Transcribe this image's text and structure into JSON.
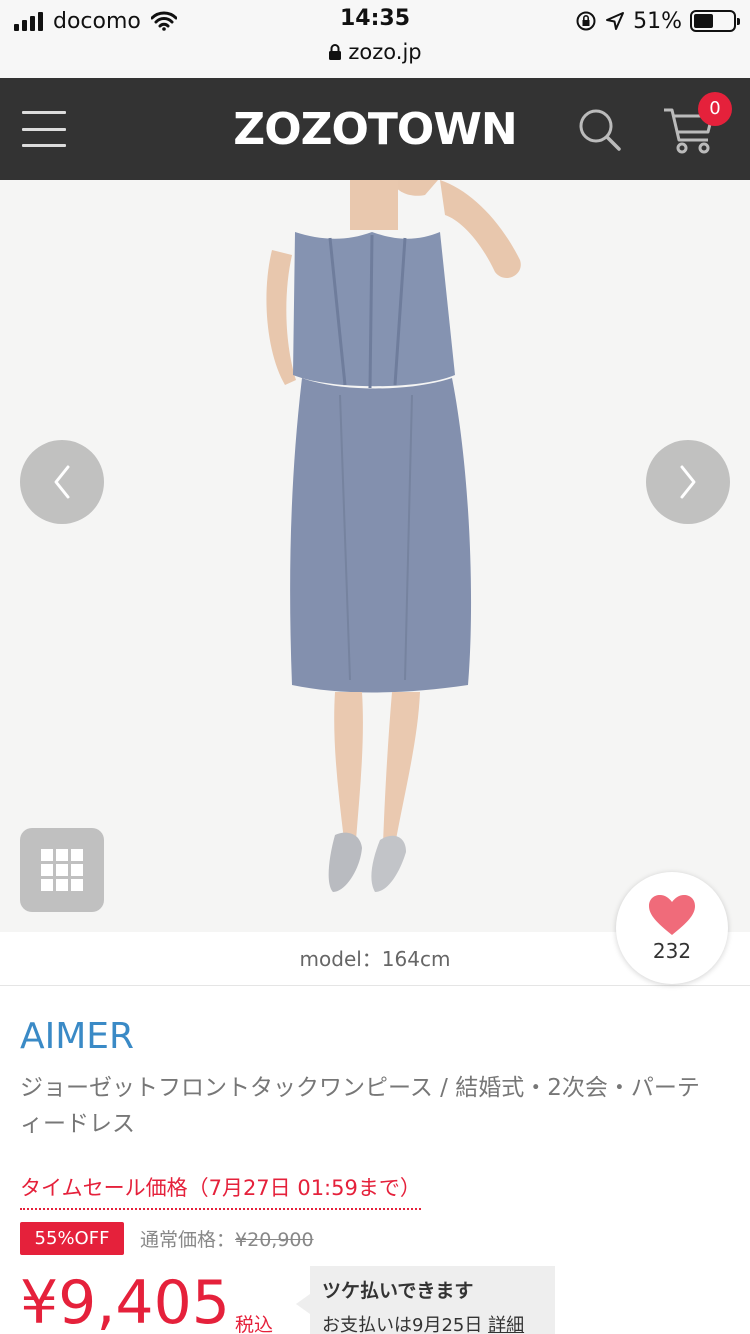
{
  "status_bar": {
    "carrier": "docomo",
    "time": "14:35",
    "battery": "51%",
    "battery_level": 0.51,
    "url": "zozo.jp"
  },
  "header": {
    "logo": "ZOZOTOWN",
    "cart_count": "0",
    "icons": [
      "menu-icon",
      "search-icon",
      "cart-icon"
    ]
  },
  "gallery": {
    "prev_icon": "chevron-left-icon",
    "next_icon": "chevron-right-icon",
    "grid_icon": "grid-icon",
    "model_info": "model：164cm"
  },
  "favorite": {
    "icon": "heart-icon",
    "count": "232",
    "color": "#f06b7a"
  },
  "product": {
    "brand": "AIMER",
    "name": "ジョーゼットフロントタックワンピース / 結婚式・2次会・パーティードレス",
    "sale_label": "タイムセール価格（7月27日 01:59まで）",
    "discount": "55%OFF",
    "regular_price_label": "通常価格：",
    "regular_price": "¥20,900",
    "sale_price": "¥9,405",
    "tax_label": "税込"
  },
  "payment": {
    "title": "ツケ払いできます",
    "subtitle": "お支払いは9月25日",
    "link": "詳細"
  },
  "colors": {
    "accent_red": "#e5213b",
    "brand_blue": "#3a8ac6",
    "header_bg": "#333333"
  }
}
